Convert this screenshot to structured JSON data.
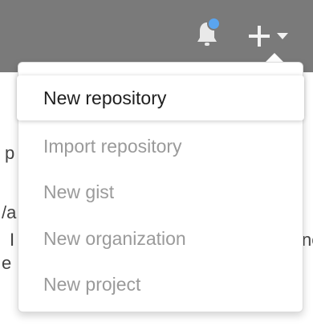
{
  "header": {
    "bell_icon": "bell-icon",
    "plus_icon": "plus-icon",
    "caret_icon": "caret-down-icon",
    "colors": {
      "bar": "#7a7a7a",
      "notification_dot": "#5aa5f0"
    }
  },
  "background": {
    "fragments": [
      "p",
      "/a",
      "I",
      "ne",
      "e"
    ]
  },
  "menu": {
    "items": [
      {
        "label": "New repository",
        "highlighted": true
      },
      {
        "label": "Import repository",
        "highlighted": false
      },
      {
        "label": "New gist",
        "highlighted": false
      },
      {
        "label": "New organization",
        "highlighted": false
      },
      {
        "label": "New project",
        "highlighted": false
      }
    ]
  }
}
